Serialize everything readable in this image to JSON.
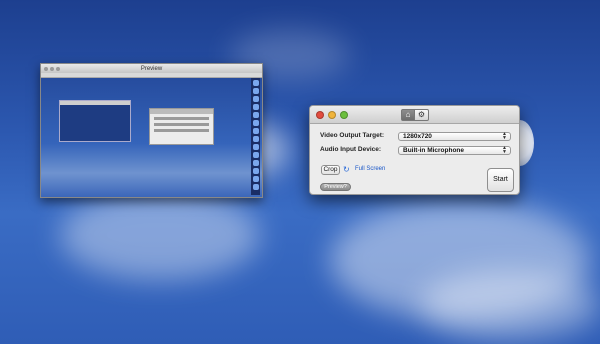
{
  "preview_window": {
    "title": "Preview"
  },
  "app_window": {
    "tabs": [
      {
        "icon": "home-icon",
        "glyph": "⌂"
      },
      {
        "icon": "gear-icon",
        "glyph": "⚙"
      }
    ],
    "form": {
      "video_label": "Video Output Target:",
      "video_value": "1280x720",
      "audio_label": "Audio Input Device:",
      "audio_value": "Built-in Microphone"
    },
    "crop_label": "Crop",
    "refresh_glyph": "↻",
    "fullscreen_label": "Full Screen",
    "preview_label": "Preview?",
    "start_label": "Start"
  },
  "colors": {
    "close": "#e24c3f",
    "minimize": "#f0b43a",
    "maximize": "#6bbf3d",
    "link": "#1a57c8"
  }
}
